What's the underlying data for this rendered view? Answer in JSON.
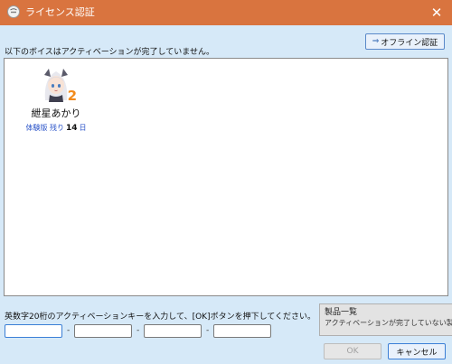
{
  "window": {
    "title": "ライセンス認証",
    "close_glyph": "✕",
    "app_icon": "chat-bubble-icon"
  },
  "toolbar": {
    "offline_arrow": "⇒",
    "offline_label": "オフライン認証"
  },
  "info_label": "以下のボイスはアクティベーションが完了していません。",
  "voices": [
    {
      "name": "紲星あかり",
      "badge": "2",
      "trial_label": "体験版 残り",
      "trial_days": "14",
      "trial_unit": "日"
    }
  ],
  "activation": {
    "instruction": "英数字20桁のアクティベーションキーを入力して、[OK]ボタンを押下してください。",
    "fields": [
      "",
      "",
      "",
      ""
    ],
    "separator": "-"
  },
  "product_list": {
    "title": "製品一覧",
    "message": "アクティベーションが完了していない製品"
  },
  "buttons": {
    "ok_label": "OK",
    "cancel_label": "キャンセル"
  },
  "colors": {
    "titlebar": "#d9743f",
    "background": "#d6e9f8",
    "link_blue": "#2852c8",
    "badge_orange": "#f28a1b"
  }
}
